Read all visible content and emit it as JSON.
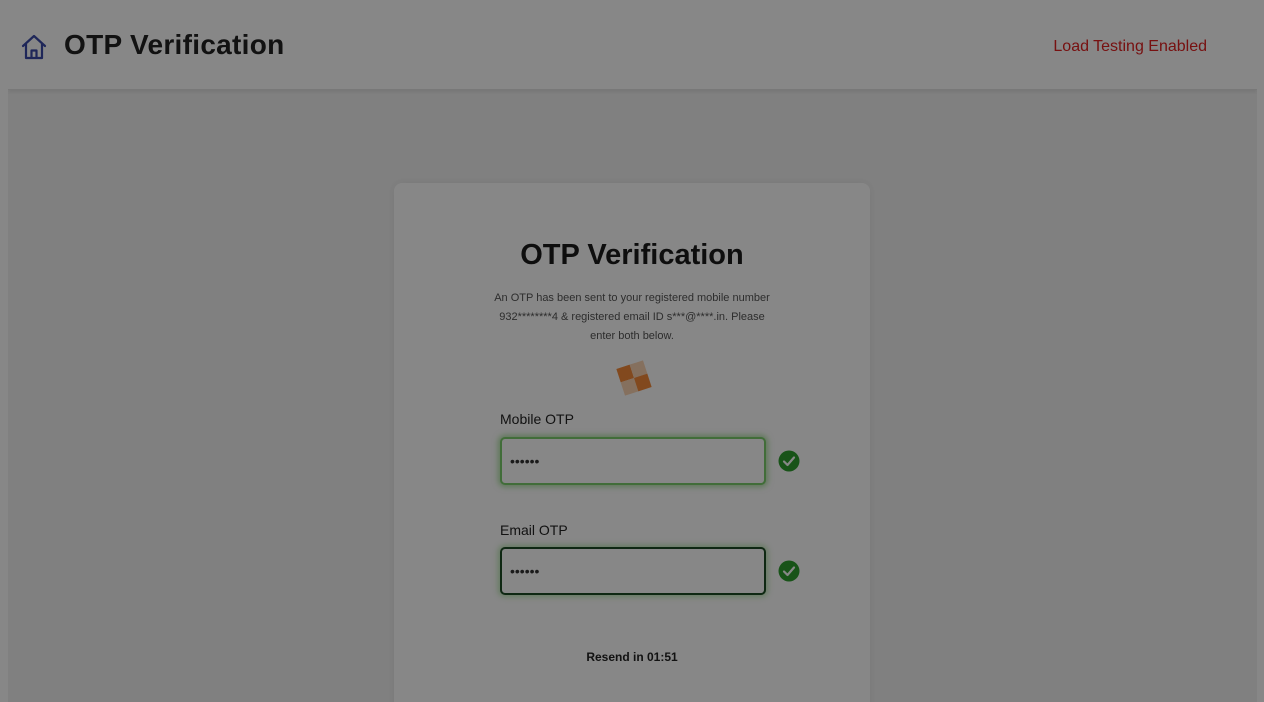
{
  "header": {
    "home_icon": "home-icon",
    "title": "OTP Verification",
    "status_link": "Load Testing Enabled"
  },
  "card": {
    "title": "OTP Verification",
    "description": "An OTP has been sent to your registered mobile number 932********4 & registered email ID s***@****.in. Please enter both below.",
    "loader_icon": "loading-spinner-icon",
    "mobile_otp": {
      "label": "Mobile OTP",
      "value": "••••••",
      "status_icon": "check-circle-icon"
    },
    "email_otp": {
      "label": "Email OTP",
      "value": "••••••",
      "status_icon": "check-circle-icon"
    },
    "resend": "Resend in 01:51"
  },
  "colors": {
    "accent_green": "#2e9e2e",
    "link_red": "#e02020",
    "home_icon": "#3b4ba8",
    "loader_orange": "#f58b3a"
  }
}
